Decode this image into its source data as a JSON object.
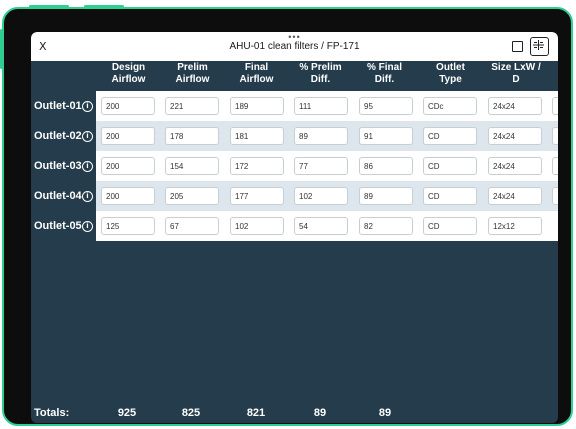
{
  "header": {
    "close_label": "X",
    "title": "AHU-01 clean filters /  FP-171",
    "more_dots": "•••"
  },
  "columns": [
    [
      "Design",
      "Airflow"
    ],
    [
      "Prelim",
      "Airflow"
    ],
    [
      "Final",
      "Airflow"
    ],
    [
      "% Prelim",
      "Diff."
    ],
    [
      "% Final",
      "Diff."
    ],
    [
      "Outlet",
      "Type"
    ],
    [
      "Size LxW /",
      "D"
    ]
  ],
  "rows": [
    {
      "label": "Outlet-01",
      "values": [
        "200",
        "221",
        "189",
        "111",
        "95",
        "CDc",
        "24x24"
      ]
    },
    {
      "label": "Outlet-02",
      "values": [
        "200",
        "178",
        "181",
        "89",
        "91",
        "CD",
        "24x24"
      ]
    },
    {
      "label": "Outlet-03",
      "values": [
        "200",
        "154",
        "172",
        "77",
        "86",
        "CD",
        "24x24"
      ]
    },
    {
      "label": "Outlet-04",
      "values": [
        "200",
        "205",
        "177",
        "102",
        "89",
        "CD",
        "24x24"
      ]
    },
    {
      "label": "Outlet-05",
      "values": [
        "125",
        "67",
        "102",
        "54",
        "82",
        "CD",
        "12x12"
      ]
    }
  ],
  "totals": {
    "label": "Totals:",
    "values": [
      "925",
      "825",
      "821",
      "89",
      "89"
    ]
  },
  "colors": {
    "accent": "#2fcf93",
    "background": "#243c4b"
  }
}
